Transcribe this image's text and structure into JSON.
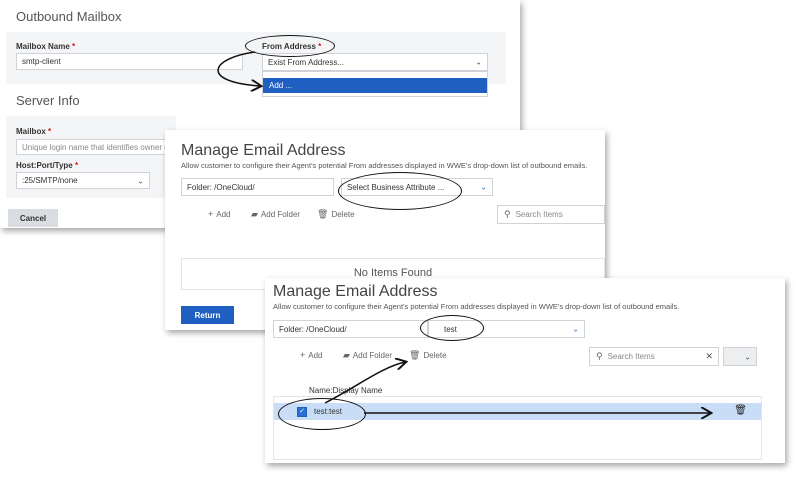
{
  "panel1": {
    "title": "Outbound Mailbox",
    "mailbox_name_label": "Mailbox Name",
    "mailbox_name_value": "smtp-client",
    "from_address_label": "From Address",
    "from_address_value": "Exist From Address...",
    "dropdown_option_add": "Add ...",
    "server_info_title": "Server Info",
    "mailbox_label": "Mailbox",
    "mailbox_placeholder": "Unique login name that identifies owner of m",
    "host_label": "Host:Port/Type",
    "host_value": ":25/SMTP/none",
    "cancel_label": "Cancel",
    "required_marker": "*"
  },
  "panel2": {
    "title": "Manage Email Address",
    "description": "Allow customer to configure their Agent's potential From addresses displayed in WWE's drop-down list of outbound emails.",
    "folder_value": "Folder: /OneCloud/",
    "business_attribute_value": "Select Business Attribute ...",
    "add_label": "Add",
    "add_folder_label": "Add Folder",
    "delete_label": "Delete",
    "search_placeholder": "Search Items",
    "empty_text": "No Items Found",
    "return_label": "Return"
  },
  "panel3": {
    "title": "Manage Email Address",
    "description": "Allow customer to configure their Agent's potential From addresses displayed in WWE's drop-down list of outbound emails.",
    "folder_value": "Folder: /OneCloud/",
    "business_attribute_value": "test",
    "add_label": "Add",
    "add_folder_label": "Add Folder",
    "delete_label": "Delete",
    "search_placeholder": "Search Items",
    "column_header": "Name:Display Name",
    "row_label": "test:test",
    "row_checked": true
  },
  "colors": {
    "accent": "#1f5fc2",
    "selected_row": "#c9ddf7",
    "panel_box": "#f4f5f7"
  }
}
